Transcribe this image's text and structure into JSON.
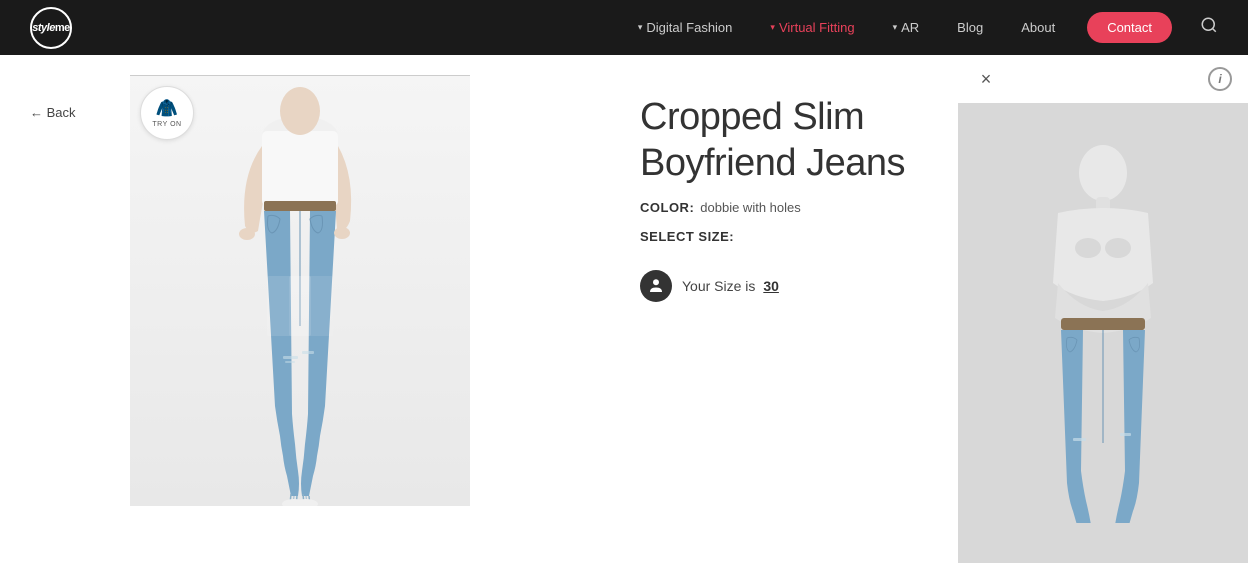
{
  "nav": {
    "logo": "styleme",
    "logo_style": "style",
    "logo_me": "me",
    "items": [
      {
        "label": "Digital Fashion",
        "hasDropdown": true,
        "active": false
      },
      {
        "label": "Virtual Fitting",
        "hasDropdown": true,
        "active": true
      },
      {
        "label": "AR",
        "hasDropdown": true,
        "active": false
      },
      {
        "label": "Blog",
        "hasDropdown": false,
        "active": false
      },
      {
        "label": "About",
        "hasDropdown": false,
        "active": false
      }
    ],
    "contact_label": "Contact",
    "search_icon": "🔍"
  },
  "product": {
    "title_line1": "Cropped Slim",
    "title_line2": "Boyfriend Jeans",
    "color_label": "COLOR:",
    "color_value": "dobbie with holes",
    "size_label": "SELECT SIZE:",
    "size_recommendation": "Your Size is",
    "size_number": "30",
    "back_label": "← Back",
    "try_on_label": "TRY ON"
  },
  "fitting_panel": {
    "close_icon": "×",
    "info_icon": "i"
  }
}
